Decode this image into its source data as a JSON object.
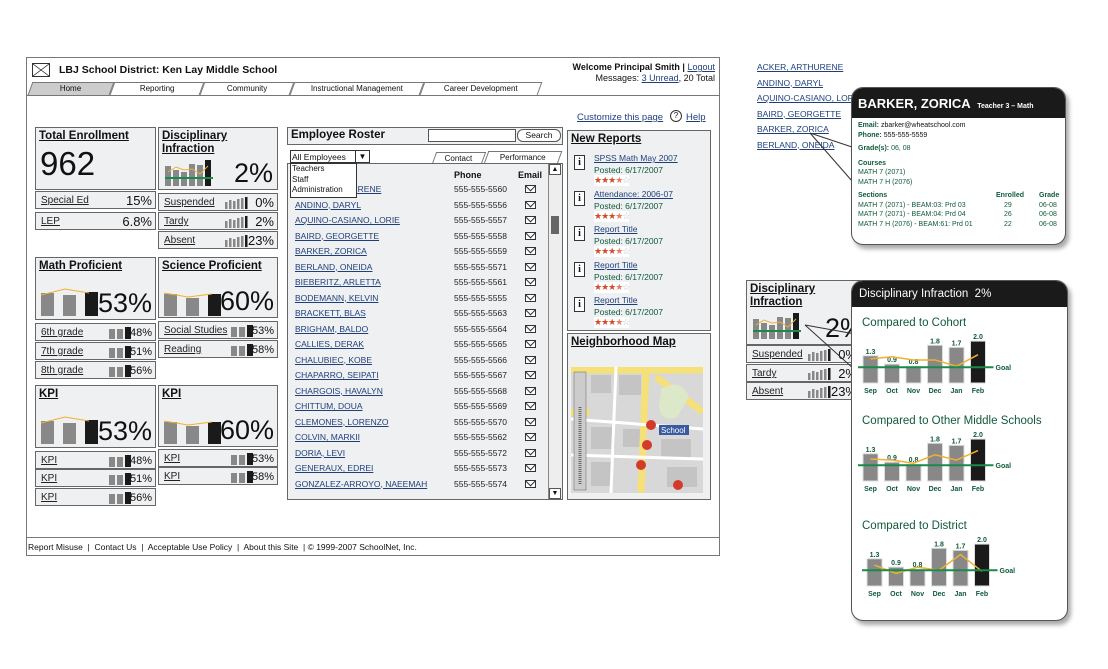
{
  "header": {
    "title": "LBJ School District: Ken Lay Middle School",
    "welcome": "Welcome Principal Smith",
    "separator": "|",
    "logout": "Logout",
    "messages_prefix": "Messages:",
    "unread": "3 Unread",
    "total": ", 20 Total"
  },
  "tabs": [
    {
      "label": "Home",
      "active": true
    },
    {
      "label": "Reporting"
    },
    {
      "label": "Community"
    },
    {
      "label": "Instructional Management"
    },
    {
      "label": "Career Development"
    }
  ],
  "customize": "Customize this page",
  "help": "Help",
  "widgets": {
    "enrollment": {
      "title": "Total Enrollment",
      "value": "962",
      "rows": [
        {
          "label": "Special Ed",
          "value": "15%"
        },
        {
          "label": "LEP",
          "value": "6.8%"
        }
      ]
    },
    "discipline": {
      "title_1": "Disciplinary ",
      "title_2": "Infraction",
      "value": "2%",
      "rows": [
        {
          "label": "Suspended",
          "value": "0%"
        },
        {
          "label": "Tardy",
          "value": "2%"
        },
        {
          "label": "Absent",
          "value": "23%"
        }
      ]
    },
    "math": {
      "title": "Math Proficient",
      "value": "53%",
      "rows": [
        {
          "label": "6th grade",
          "value": "48%"
        },
        {
          "label": "7th grade",
          "value": "51%"
        },
        {
          "label": "8th grade",
          "value": "56%"
        }
      ]
    },
    "science": {
      "title": "Science Proficient",
      "value": "60%",
      "rows": [
        {
          "label": "Social Studies",
          "value": "53%"
        },
        {
          "label": "Reading",
          "value": "58%"
        }
      ]
    },
    "kpi1": {
      "title": "KPI",
      "value": "53%",
      "rows": [
        {
          "label": "KPI",
          "value": "48%"
        },
        {
          "label": "KPI",
          "value": "51%"
        },
        {
          "label": "KPI",
          "value": "56%"
        }
      ]
    },
    "kpi2": {
      "title": "KPI",
      "value": "60%",
      "rows": [
        {
          "label": "KPI",
          "value": "53%"
        },
        {
          "label": "KPI",
          "value": "58%"
        }
      ]
    }
  },
  "roster": {
    "title": "Employee Roster",
    "search_value": "",
    "search_button": "Search",
    "filter": "All Employees",
    "filter_options": [
      "Teachers",
      "Staff",
      "Administration"
    ],
    "tabs": [
      "Contact",
      "Performance"
    ],
    "col_phone": "Phone",
    "col_email": "Email",
    "employees": [
      {
        "name": "ACKER, ARTHURENE",
        "phone": "555-555-5560"
      },
      {
        "name": "ANDINO, DARYL",
        "phone": "555-555-5556"
      },
      {
        "name": "AQUINO-CASIANO, LORIE",
        "phone": "555-555-5557"
      },
      {
        "name": "BAIRD, GEORGETTE",
        "phone": "555-555-5558"
      },
      {
        "name": "BARKER, ZORICA",
        "phone": "555-555-5559"
      },
      {
        "name": "BERLAND, ONEIDA",
        "phone": "555-555-5571"
      },
      {
        "name": "BIEBERITZ, ARLETTA",
        "phone": "555-555-5561"
      },
      {
        "name": "BODEMANN, KELVIN",
        "phone": "555-555-5555"
      },
      {
        "name": "BRACKETT, BLAS",
        "phone": "555-555-5563"
      },
      {
        "name": "BRIGHAM, BALDO",
        "phone": "555-555-5564"
      },
      {
        "name": "CALLIES, DERAK",
        "phone": "555-555-5565"
      },
      {
        "name": "CHALUBIEC, KOBE",
        "phone": "555-555-5566"
      },
      {
        "name": "CHAPARRO, SEIPATI",
        "phone": "555-555-5567"
      },
      {
        "name": "CHARGOIS, HAVALYN",
        "phone": "555-555-5568"
      },
      {
        "name": "CHITTUM, DOUA",
        "phone": "555-555-5569"
      },
      {
        "name": "CLEMONES, LORENZO",
        "phone": "555-555-5570"
      },
      {
        "name": "COLVIN, MARKII",
        "phone": "555-555-5562"
      },
      {
        "name": "DORIA, LEVI",
        "phone": "555-555-5572"
      },
      {
        "name": "GENERAUX, EDREI",
        "phone": "555-555-5573"
      },
      {
        "name": "GONZALEZ-ARROYO, NAEEMAH",
        "phone": "555-555-5574"
      }
    ]
  },
  "reports": {
    "title": "New Reports",
    "items": [
      {
        "title": "SPSS Math May 2007",
        "posted": "Posted: 6/17/2007",
        "rating": 3.5
      },
      {
        "title": "Attendance: 2006-07",
        "posted": "Posted: 6/17/2007",
        "rating": 3.5
      },
      {
        "title": "Report Title",
        "posted": "Posted: 6/17/2007",
        "rating": 3.5
      },
      {
        "title": "Report Title",
        "posted": "Posted: 6/17/2007",
        "rating": 3.5
      },
      {
        "title": "Report Title",
        "posted": "Posted: 6/17/2007",
        "rating": 3.5
      }
    ]
  },
  "map": {
    "title": "Neighborhood Map",
    "label": "School",
    "markers": [
      "F",
      "A",
      "J",
      "H"
    ]
  },
  "footer": {
    "links": [
      "Report Misuse",
      "Contact Us",
      "Acceptable Use Policy",
      "About this Site"
    ],
    "copyright": "© 1999-2007 SchoolNet, Inc."
  },
  "side_list": [
    "ACKER, ARTHURENE",
    "ANDINO, DARYL",
    "AQUINO-CASIANO, LORIE",
    "BAIRD, GEORGETTE",
    "BARKER, ZORICA",
    "BERLAND, ONEIDA"
  ],
  "profile": {
    "name": "BARKER, ZORICA",
    "role": "Teacher 3 – Math",
    "email_label": "Email:",
    "email": "zbarker@wheatschool.com",
    "phone_label": "Phone:",
    "phone": "555-555-5559",
    "grades_label": "Grade(s):",
    "grades": "06, 08",
    "courses_label": "Courses",
    "courses": [
      "MATH 7 (2071)",
      "MATH 7 H (2076)"
    ],
    "sections_label": "Sections",
    "enrolled_label": "Enrolled",
    "grade_label": "Grade",
    "sections": [
      {
        "name": "MATH 7 (2071) - BEAM:03: Prd 03",
        "enrolled": "29",
        "grade": "06-08"
      },
      {
        "name": "MATH 7 (2071) - BEAM:04: Prd 04",
        "enrolled": "26",
        "grade": "06-08"
      },
      {
        "name": "MATH 7 H (2076) - BEAM:61: Prd 01",
        "enrolled": "22",
        "grade": "06-08"
      }
    ]
  },
  "mini_discipline": {
    "title_1": "Disciplinary ",
    "title_2": "Infraction",
    "value": "2%",
    "rows": [
      {
        "label": "Suspended",
        "value": "0%"
      },
      {
        "label": "Tardy",
        "value": "2%"
      },
      {
        "label": "Absent",
        "value": "23%"
      }
    ]
  },
  "detail": {
    "title": "Disciplinary Infraction  2%"
  },
  "colors": {
    "bar": "#888888",
    "bar_current": "#1a1a1a",
    "trend": "#f0b030",
    "goal": "#1a8a4a",
    "text_green": "#0f5a3a",
    "link": "#1f3f7a"
  },
  "chart_data": [
    {
      "type": "bar",
      "title": "Compared to Cohort",
      "categories": [
        "Sep",
        "Oct",
        "Nov",
        "Dec",
        "Jan",
        "Feb"
      ],
      "values": [
        1.3,
        0.9,
        0.8,
        1.8,
        1.7,
        2.0
      ],
      "data_labels": [
        "1.3",
        "0.9",
        "0.8",
        "1.8",
        "1.7",
        "2.0"
      ],
      "comparison_line": [
        1.15,
        1.25,
        1.1,
        1.1,
        0.8,
        1.35
      ],
      "goal": 0.75,
      "goal_label": "Goal",
      "ylim": [
        0,
        2.1
      ]
    },
    {
      "type": "bar",
      "title": "Compared to Other Middle Schools",
      "categories": [
        "Sep",
        "Oct",
        "Nov",
        "Dec",
        "Jan",
        "Feb"
      ],
      "values": [
        1.3,
        0.9,
        0.8,
        1.8,
        1.7,
        2.0
      ],
      "data_labels": [
        "1.3",
        "0.9",
        "0.8",
        "1.8",
        "1.7",
        "2.0"
      ],
      "comparison_line": [
        1.05,
        1.0,
        0.85,
        1.25,
        1.0,
        1.45
      ],
      "goal": 0.75,
      "goal_label": "Goal",
      "ylim": [
        0,
        2.1
      ]
    },
    {
      "type": "bar",
      "title": "Compared to District",
      "categories": [
        "Sep",
        "Oct",
        "Nov",
        "Dec",
        "Jan",
        "Feb"
      ],
      "values": [
        1.3,
        0.9,
        0.8,
        1.8,
        1.7,
        2.0
      ],
      "data_labels": [
        "1.3",
        "0.9",
        "0.8",
        "1.8",
        "1.7",
        "2.0"
      ],
      "comparison_line": [
        1.0,
        0.6,
        0.9,
        0.75,
        1.5,
        0.7
      ],
      "goal": 0.75,
      "goal_label": "Goal",
      "ylim": [
        0,
        2.1
      ]
    }
  ]
}
